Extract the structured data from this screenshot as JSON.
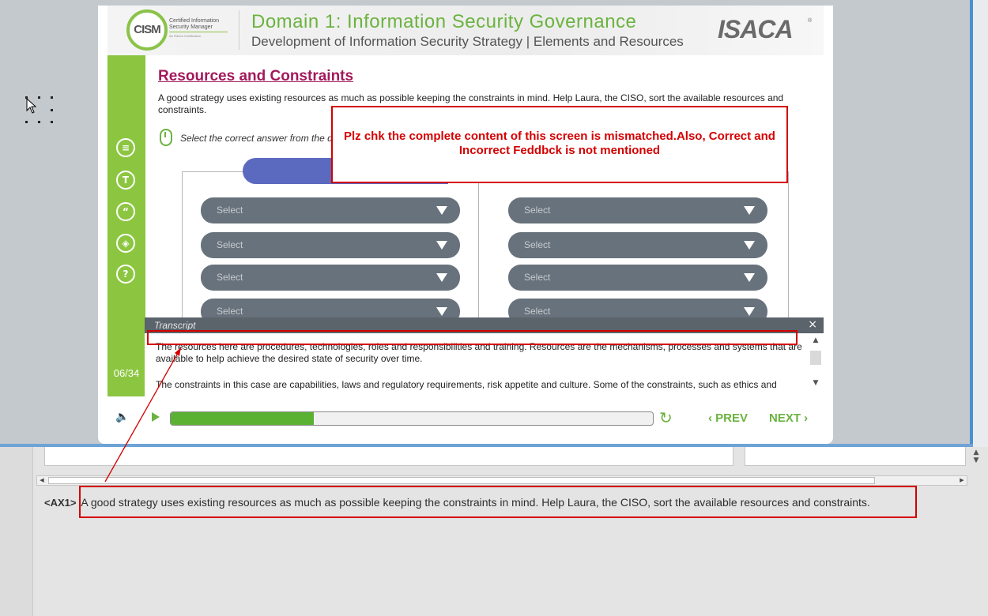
{
  "slide": {
    "logo_text": "CISM",
    "logo_sub": "Certified Information Security Manager",
    "logo_sub2": "An ISACA Certification",
    "domain_title": "Domain 1: Information Security Governance",
    "domain_subtitle": "Development of Information Security Strategy | Elements and Resources",
    "brand": "ISACA",
    "brand_mark": "®",
    "content_title": "Resources and Constraints",
    "content_text": "A good strategy uses existing resources as much as possible keeping the constraints in mind. Help Laura, the CISO, sort the available resources and constraints.",
    "instruction": "Select the correct answer from the d",
    "column_left_header": "Reso",
    "page_counter": "06/34",
    "rail_icons": [
      "document-icon",
      "glossary-icon",
      "quote-icon",
      "layers-icon",
      "help-icon"
    ],
    "rail_glyphs": [
      "≡",
      "T",
      "“",
      "◈",
      "?"
    ],
    "selects_left": [
      "Select",
      "Select",
      "Select",
      "Select"
    ],
    "selects_right": [
      "Select",
      "Select",
      "Select",
      "Select"
    ],
    "colors": {
      "green": "#8cc641",
      "accent_blue": "#5b6abf",
      "title_magenta": "#a3195b",
      "select_grey": "#68727c"
    }
  },
  "transcript": {
    "label": "Transcript",
    "close": "×",
    "paragraphs": [
      "The resources here are procedures, technologies, roles and responsibilities and training. Resources are the mechanisms, processes and systems that are available to help achieve the desired state of security over time.",
      "The constraints in this case are capabilities, laws and regulatory requirements, risk appetite and culture. Some of the constraints, such as ethics and"
    ]
  },
  "player": {
    "progress_fraction": 0.297,
    "prev_label": "‹ PREV",
    "next_label": "NEXT ›",
    "volume_glyph": "🔈",
    "replay_glyph": "↻"
  },
  "review": {
    "comment": "Plz chk the complete content of this screen is mismatched.Also, Correct and Incorrect Feddbck is not mentioned"
  },
  "editor": {
    "segment_tag": "<AX1>",
    "segment_text": "A good strategy uses existing resources as much as possible keeping the constraints in mind. Help Laura, the CISO, sort the available resources and constraints.",
    "scroll_left": "◀",
    "scroll_right": "▶",
    "side_arrows": "▲\n▼"
  }
}
